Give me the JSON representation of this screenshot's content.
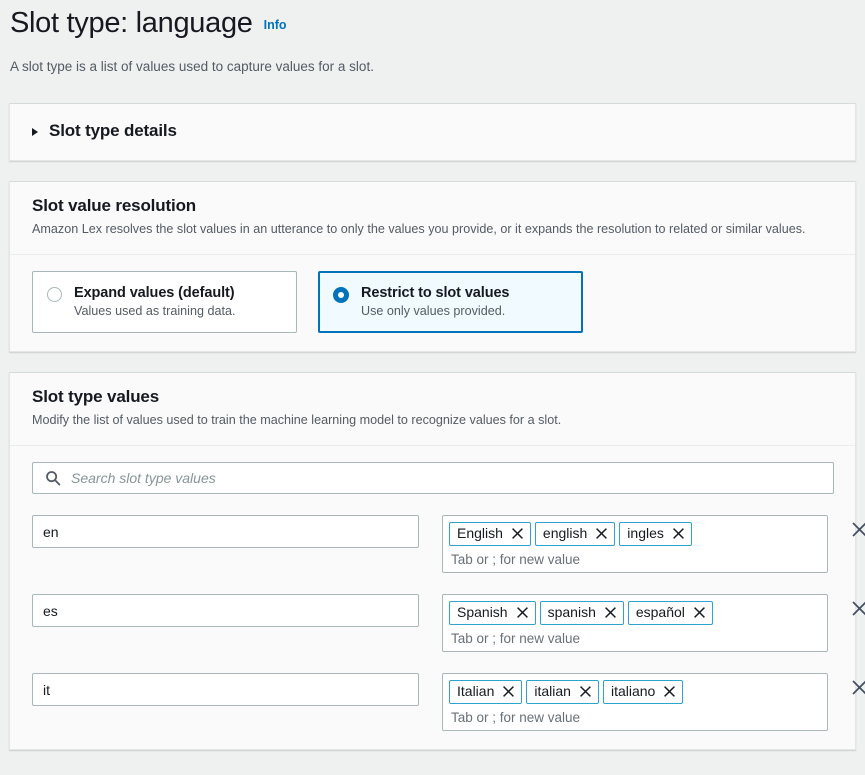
{
  "header": {
    "title": "Slot type: language",
    "info_label": "Info",
    "description": "A slot type is a list of values used to capture values for a slot."
  },
  "details_section": {
    "title": "Slot type details",
    "expanded": false,
    "caret_icon": "caret-right-icon"
  },
  "resolution_section": {
    "title": "Slot value resolution",
    "description": "Amazon Lex resolves the slot values in an utterance to only the values you provide, or it expands the resolution to related or similar values.",
    "options": [
      {
        "label": "Expand values (default)",
        "description": "Values used as training data.",
        "selected": false
      },
      {
        "label": "Restrict to slot values",
        "description": "Use only values provided.",
        "selected": true
      }
    ]
  },
  "values_section": {
    "title": "Slot type values",
    "description": "Modify the list of values used to train the machine learning model to recognize values for a slot.",
    "search": {
      "placeholder": "Search slot type values",
      "value": "",
      "icon": "search-icon"
    },
    "tag_hint": "Tab or ; for new value",
    "delete_row_icon": "close-icon",
    "rows": [
      {
        "value": "en",
        "synonyms": [
          "English",
          "english",
          "ingles"
        ]
      },
      {
        "value": "es",
        "synonyms": [
          "Spanish",
          "spanish",
          "español"
        ]
      },
      {
        "value": "it",
        "synonyms": [
          "Italian",
          "italian",
          "italiano"
        ]
      }
    ]
  },
  "colors": {
    "page_background": "#eff0f0",
    "panel_background": "#fafafa",
    "accent_blue": "#0073bb",
    "selected_tile_background": "#f1faff",
    "tag_border": "#2ea3cd",
    "secondary_text": "#545b64",
    "border": "#aab7b8"
  }
}
